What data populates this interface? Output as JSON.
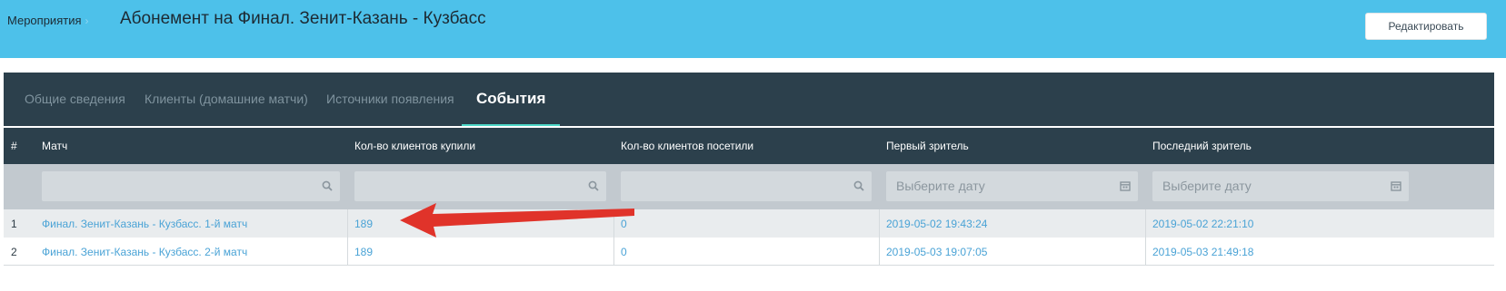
{
  "header": {
    "breadcrumb": "Мероприятия",
    "title": "Абонемент на Финал. Зенит-Казань - Кузбасс",
    "edit_button": "Редактировать"
  },
  "tabs": [
    {
      "label": "Общие сведения",
      "active": false
    },
    {
      "label": "Клиенты (домашние матчи)",
      "active": false
    },
    {
      "label": "Источники появления",
      "active": false
    },
    {
      "label": "События",
      "active": true
    }
  ],
  "table": {
    "columns": [
      "#",
      "Матч",
      "Кол-во клиентов купили",
      "Кол-во клиентов посетили",
      "Первый зритель",
      "Последний зритель"
    ],
    "filters": {
      "date_placeholder": "Выберите дату"
    },
    "rows": [
      {
        "num": "1",
        "match": "Финал. Зенит-Казань - Кузбасс. 1-й матч",
        "bought": "189",
        "visited": "0",
        "first": "2019-05-02 19:43:24",
        "last": "2019-05-02 22:21:10"
      },
      {
        "num": "2",
        "match": "Финал. Зенит-Казань - Кузбасс. 2-й матч",
        "bought": "189",
        "visited": "0",
        "first": "2019-05-03 19:07:05",
        "last": "2019-05-03 21:49:18"
      }
    ]
  },
  "icons": {
    "search": "search-icon",
    "calendar": "calendar-icon",
    "annotation_arrow": "red-arrow"
  },
  "colors": {
    "header_bg": "#4dc1ea",
    "panel_bg": "#2c404c",
    "active_tab_underline": "#4ed8c8",
    "link": "#4aa3d6",
    "arrow": "#e0332a"
  }
}
